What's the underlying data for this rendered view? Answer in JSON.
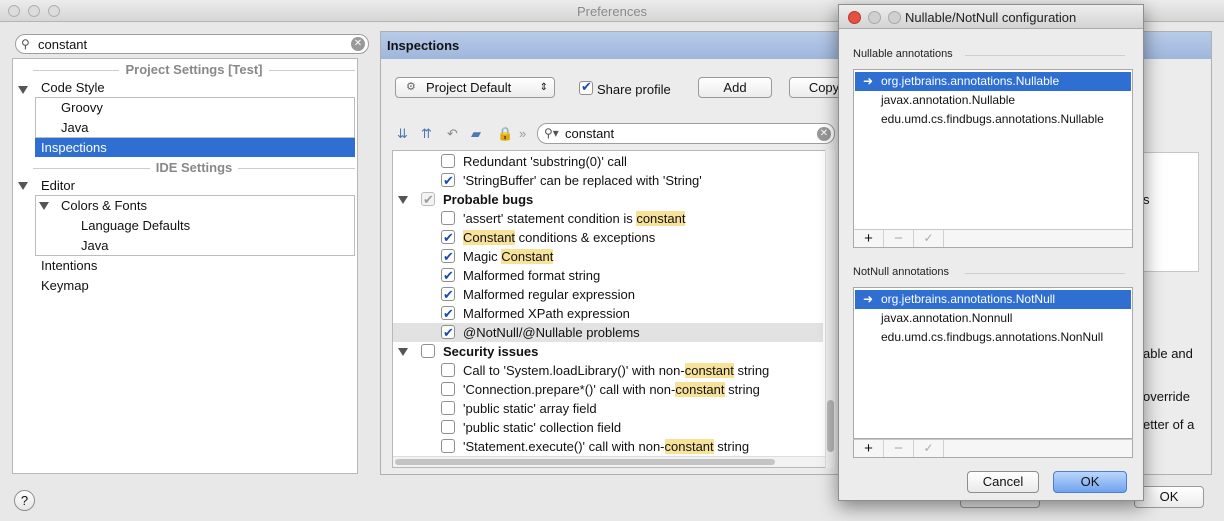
{
  "window": {
    "title": "Preferences"
  },
  "search": {
    "value": "constant"
  },
  "tree": {
    "section_project": "Project Settings [Test]",
    "code_style": "Code Style",
    "groovy": "Groovy",
    "java": "Java",
    "inspections": "Inspections",
    "section_ide": "IDE Settings",
    "editor": "Editor",
    "colors_fonts": "Colors & Fonts",
    "language_defaults": "Language Defaults",
    "java2": "Java",
    "intentions": "Intentions",
    "keymap": "Keymap"
  },
  "panel": {
    "header": "Inspections",
    "profile": "Project Default",
    "share_profile": "Share profile",
    "add": "Add",
    "copy": "Copy",
    "filter_value": "constant"
  },
  "inspections": [
    {
      "kind": "item",
      "text": "Redundant 'substring(0)' call",
      "checked": false
    },
    {
      "kind": "item",
      "text": "'StringBuffer' can be replaced with 'String'",
      "checked": true
    },
    {
      "kind": "group",
      "text": "Probable bugs",
      "checked": true
    },
    {
      "kind": "item",
      "pre": "'assert' statement condition is ",
      "hl": "constant",
      "post": "",
      "checked": false
    },
    {
      "kind": "item",
      "pre": "",
      "hl": "Constant",
      "post": " conditions & exceptions",
      "checked": true
    },
    {
      "kind": "item",
      "pre": "Magic ",
      "hl": "Constant",
      "post": "",
      "checked": true
    },
    {
      "kind": "item",
      "text": "Malformed format string",
      "checked": true
    },
    {
      "kind": "item",
      "text": "Malformed regular expression",
      "checked": true
    },
    {
      "kind": "item",
      "text": "Malformed XPath expression",
      "checked": true
    },
    {
      "kind": "item",
      "text": "@NotNull/@Nullable problems",
      "checked": true
    },
    {
      "kind": "group",
      "text": "Security issues",
      "checked": false
    },
    {
      "kind": "item",
      "pre": "Call to 'System.loadLibrary()' with non-",
      "hl": "constant",
      "post": " string",
      "checked": false
    },
    {
      "kind": "item",
      "pre": "'Connection.prepare*()' call with non-",
      "hl": "constant",
      "post": " string",
      "checked": false
    },
    {
      "kind": "item",
      "text": "'public static' array field",
      "checked": false
    },
    {
      "kind": "item",
      "text": "'public static' collection field",
      "checked": false
    },
    {
      "kind": "item",
      "pre": "'Statement.execute()' call with non-",
      "hl": "constant",
      "post": " string",
      "checked": false
    }
  ],
  "right_fragments": {
    "s": "s",
    "able_and": "able and",
    "override": "override",
    "etter_of_a": "etter of a",
    "ok": "OK"
  },
  "dialog": {
    "title": "Nullable/NotNull configuration",
    "nullable_label": "Nullable annotations",
    "nullable": [
      "org.jetbrains.annotations.Nullable",
      "javax.annotation.Nullable",
      "edu.umd.cs.findbugs.annotations.Nullable"
    ],
    "notnull_label": "NotNull annotations",
    "notnull": [
      "org.jetbrains.annotations.NotNull",
      "javax.annotation.Nonnull",
      "edu.umd.cs.findbugs.annotations.NonNull"
    ],
    "plus": "+",
    "minus": "−",
    "check": "✓",
    "cancel": "Cancel",
    "ok": "OK"
  },
  "help": "?"
}
